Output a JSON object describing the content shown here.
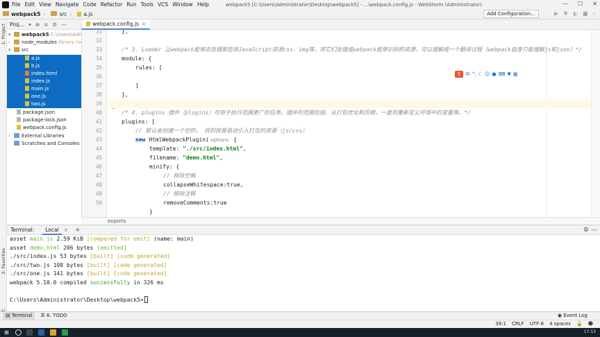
{
  "menubar": {
    "items": [
      "File",
      "Edit",
      "View",
      "Navigate",
      "Code",
      "Refactor",
      "Run",
      "Tools",
      "VCS",
      "Window",
      "Help"
    ],
    "window_title": "webpack5 [C:\\Users\\Administrator\\Desktop\\webpack5] - ...\\webpack.config.js - WebStorm (Administrator)"
  },
  "navbar": {
    "crumbs": [
      "webpack5",
      "src",
      "a.js"
    ],
    "add_configuration": "Add Configuration..."
  },
  "sidebar_strip": {
    "project": "1: Project",
    "favorites": "2: Favorites",
    "structure": "Z: Structure"
  },
  "project_panel": {
    "title": "Proj...",
    "tree": [
      {
        "label": "webpack5",
        "extra": "C:\\Users\\Administra",
        "type": "root"
      },
      {
        "label": "node_modules",
        "extra": "library root",
        "type": "folder"
      },
      {
        "label": "src",
        "extra": "",
        "type": "folder"
      },
      {
        "label": "a.js",
        "extra": "",
        "type": "js"
      },
      {
        "label": "b.js",
        "extra": "",
        "type": "js"
      },
      {
        "label": "index.html",
        "extra": "",
        "type": "html"
      },
      {
        "label": "index.js",
        "extra": "",
        "type": "js"
      },
      {
        "label": "main.js",
        "extra": "",
        "type": "js"
      },
      {
        "label": "one.js",
        "extra": "",
        "type": "js"
      },
      {
        "label": "two.js",
        "extra": "",
        "type": "js"
      },
      {
        "label": "package.json",
        "extra": "",
        "type": "json"
      },
      {
        "label": "package-lock.json",
        "extra": "",
        "type": "json"
      },
      {
        "label": "webpack.config.js",
        "extra": "",
        "type": "js"
      },
      {
        "label": "External Libraries",
        "extra": "",
        "type": "lib"
      },
      {
        "label": "Scratches and Consoles",
        "extra": "",
        "type": "lib"
      }
    ]
  },
  "editor": {
    "tab": "webpack.config.js",
    "line_numbers": [
      "31",
      "32",
      "33",
      "34",
      "35",
      "36",
      "37",
      "38",
      "39",
      "40",
      "41",
      "42",
      "43",
      "44",
      "45",
      "46",
      "47",
      "48",
      "49",
      "50"
    ],
    "lines": {
      "l31": "},",
      "l33_comment": "/* 3. Loader 让webpack能够去处理那些非JavaScript资源css、img等，将它们处理成webpack能够识别的资源，可以理解成一个翻译过程（webpack自身只能理解js和json）*/",
      "l34": "module: {",
      "l35": "rules: [",
      "l36": "",
      "l37": "]",
      "l38": "},",
      "l40_comment": "/* 4. plugins 插件（plugins）可用于执行范围更广的任务。插件的范围包括，从打包优化和压缩，一直到重新定义环境中的变量等。*/",
      "l41": "plugins: [",
      "l42_comment": "// 默认会创建一个空的， 目的就是自动引入打包的资源（js/css）",
      "l43_kw": "new",
      "l43_name": " HtmlWebpackPlugin(",
      "l43_hint": " options:",
      "l43_tail": " {",
      "l44_key": "template: ",
      "l44_val": "\"./src/index.html\"",
      "l44_tail": ",",
      "l45_key": "filename: ",
      "l45_val": "\"demo.html\"",
      "l45_tail": ",",
      "l46": "minify: {",
      "l47_comment": "// 移除空格",
      "l48": "collapseWhitespace:true,",
      "l49_comment": "// 移除注释",
      "l50": "removeComments:true",
      "l51": "}"
    },
    "breadcrumb": "exports"
  },
  "terminal": {
    "title": "Terminal:",
    "tab": "Local",
    "lines": [
      {
        "pre": "asset ",
        "name": "main.js",
        "mid": " 2.59 KiB ",
        "tag1": "[compared for emit]",
        "post": " (name: main)"
      },
      {
        "pre": "asset ",
        "name": "demo.html",
        "mid": " 206 bytes ",
        "tag1": "[emitted]",
        "post": ""
      },
      {
        "pre": "./src/index.js 53 bytes ",
        "name": "",
        "mid": "",
        "tag1": "[built]",
        "tag2": "[code generated]"
      },
      {
        "pre": "./src/two.js 108 bytes ",
        "name": "",
        "mid": "",
        "tag1": "[built]",
        "tag2": "[code generated]"
      },
      {
        "pre": "./src/one.js 141 bytes ",
        "name": "",
        "mid": "",
        "tag1": "[built]",
        "tag2": "[code generated]"
      }
    ],
    "compiled_pre": "webpack 5.10.0 compiled ",
    "compiled_word": "successfully",
    "compiled_post": " in 326 ms",
    "prompt": "C:\\Users\\Administrator\\Desktop\\webpack5>"
  },
  "toolwindows": {
    "terminal": "Terminal",
    "todo": "6: TODO",
    "event_log": "Event Log"
  },
  "statusbar": {
    "position": "38:1",
    "line_sep": "CRLF",
    "encoding": "UTF-8",
    "indent": "4 spaces"
  },
  "taskbar": {
    "clock": "17:13"
  },
  "colors": {
    "selection": "#0d6cc2",
    "comment": "#8c8c8c",
    "keyword": "#0033b3",
    "string": "#067d17",
    "terminal_green": "#6ab82e",
    "terminal_yellow": "#b8a62c"
  }
}
